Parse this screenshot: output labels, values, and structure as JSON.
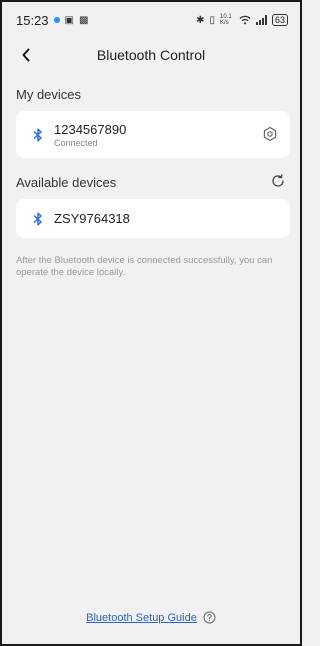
{
  "status_bar": {
    "time": "15:23",
    "battery": "63",
    "network_speed": "10.1 K/s"
  },
  "header": {
    "title": "Bluetooth Control",
    "back_icon": "chevron-left-icon"
  },
  "my_devices": {
    "label": "My devices",
    "items": [
      {
        "name": "1234567890",
        "status": "Connected",
        "icon": "bluetooth-icon",
        "action_icon": "gear-icon"
      }
    ]
  },
  "available_devices": {
    "label": "Available devices",
    "refresh_icon": "refresh-icon",
    "items": [
      {
        "name": "ZSY9764318",
        "icon": "bluetooth-icon"
      }
    ]
  },
  "hint": "After the Bluetooth device is connected successfully, you can operate the device locally.",
  "footer": {
    "guide_label": "Bluetooth Setup Guide",
    "help_icon": "question-circle-icon"
  },
  "colors": {
    "accent": "#2a64c8",
    "bluetooth": "#2f6fe0",
    "background": "#f1f1f3"
  }
}
